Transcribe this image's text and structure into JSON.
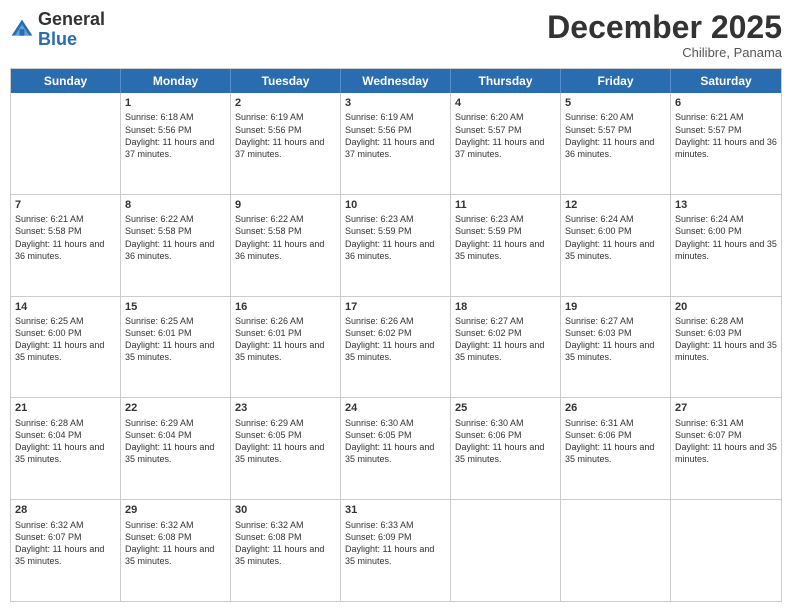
{
  "logo": {
    "general": "General",
    "blue": "Blue"
  },
  "title": "December 2025",
  "subtitle": "Chilibre, Panama",
  "header_days": [
    "Sunday",
    "Monday",
    "Tuesday",
    "Wednesday",
    "Thursday",
    "Friday",
    "Saturday"
  ],
  "weeks": [
    [
      {
        "day": "",
        "sunrise": "",
        "sunset": "",
        "daylight": ""
      },
      {
        "day": "1",
        "sunrise": "Sunrise: 6:18 AM",
        "sunset": "Sunset: 5:56 PM",
        "daylight": "Daylight: 11 hours and 37 minutes."
      },
      {
        "day": "2",
        "sunrise": "Sunrise: 6:19 AM",
        "sunset": "Sunset: 5:56 PM",
        "daylight": "Daylight: 11 hours and 37 minutes."
      },
      {
        "day": "3",
        "sunrise": "Sunrise: 6:19 AM",
        "sunset": "Sunset: 5:56 PM",
        "daylight": "Daylight: 11 hours and 37 minutes."
      },
      {
        "day": "4",
        "sunrise": "Sunrise: 6:20 AM",
        "sunset": "Sunset: 5:57 PM",
        "daylight": "Daylight: 11 hours and 37 minutes."
      },
      {
        "day": "5",
        "sunrise": "Sunrise: 6:20 AM",
        "sunset": "Sunset: 5:57 PM",
        "daylight": "Daylight: 11 hours and 36 minutes."
      },
      {
        "day": "6",
        "sunrise": "Sunrise: 6:21 AM",
        "sunset": "Sunset: 5:57 PM",
        "daylight": "Daylight: 11 hours and 36 minutes."
      }
    ],
    [
      {
        "day": "7",
        "sunrise": "Sunrise: 6:21 AM",
        "sunset": "Sunset: 5:58 PM",
        "daylight": "Daylight: 11 hours and 36 minutes."
      },
      {
        "day": "8",
        "sunrise": "Sunrise: 6:22 AM",
        "sunset": "Sunset: 5:58 PM",
        "daylight": "Daylight: 11 hours and 36 minutes."
      },
      {
        "day": "9",
        "sunrise": "Sunrise: 6:22 AM",
        "sunset": "Sunset: 5:58 PM",
        "daylight": "Daylight: 11 hours and 36 minutes."
      },
      {
        "day": "10",
        "sunrise": "Sunrise: 6:23 AM",
        "sunset": "Sunset: 5:59 PM",
        "daylight": "Daylight: 11 hours and 36 minutes."
      },
      {
        "day": "11",
        "sunrise": "Sunrise: 6:23 AM",
        "sunset": "Sunset: 5:59 PM",
        "daylight": "Daylight: 11 hours and 35 minutes."
      },
      {
        "day": "12",
        "sunrise": "Sunrise: 6:24 AM",
        "sunset": "Sunset: 6:00 PM",
        "daylight": "Daylight: 11 hours and 35 minutes."
      },
      {
        "day": "13",
        "sunrise": "Sunrise: 6:24 AM",
        "sunset": "Sunset: 6:00 PM",
        "daylight": "Daylight: 11 hours and 35 minutes."
      }
    ],
    [
      {
        "day": "14",
        "sunrise": "Sunrise: 6:25 AM",
        "sunset": "Sunset: 6:00 PM",
        "daylight": "Daylight: 11 hours and 35 minutes."
      },
      {
        "day": "15",
        "sunrise": "Sunrise: 6:25 AM",
        "sunset": "Sunset: 6:01 PM",
        "daylight": "Daylight: 11 hours and 35 minutes."
      },
      {
        "day": "16",
        "sunrise": "Sunrise: 6:26 AM",
        "sunset": "Sunset: 6:01 PM",
        "daylight": "Daylight: 11 hours and 35 minutes."
      },
      {
        "day": "17",
        "sunrise": "Sunrise: 6:26 AM",
        "sunset": "Sunset: 6:02 PM",
        "daylight": "Daylight: 11 hours and 35 minutes."
      },
      {
        "day": "18",
        "sunrise": "Sunrise: 6:27 AM",
        "sunset": "Sunset: 6:02 PM",
        "daylight": "Daylight: 11 hours and 35 minutes."
      },
      {
        "day": "19",
        "sunrise": "Sunrise: 6:27 AM",
        "sunset": "Sunset: 6:03 PM",
        "daylight": "Daylight: 11 hours and 35 minutes."
      },
      {
        "day": "20",
        "sunrise": "Sunrise: 6:28 AM",
        "sunset": "Sunset: 6:03 PM",
        "daylight": "Daylight: 11 hours and 35 minutes."
      }
    ],
    [
      {
        "day": "21",
        "sunrise": "Sunrise: 6:28 AM",
        "sunset": "Sunset: 6:04 PM",
        "daylight": "Daylight: 11 hours and 35 minutes."
      },
      {
        "day": "22",
        "sunrise": "Sunrise: 6:29 AM",
        "sunset": "Sunset: 6:04 PM",
        "daylight": "Daylight: 11 hours and 35 minutes."
      },
      {
        "day": "23",
        "sunrise": "Sunrise: 6:29 AM",
        "sunset": "Sunset: 6:05 PM",
        "daylight": "Daylight: 11 hours and 35 minutes."
      },
      {
        "day": "24",
        "sunrise": "Sunrise: 6:30 AM",
        "sunset": "Sunset: 6:05 PM",
        "daylight": "Daylight: 11 hours and 35 minutes."
      },
      {
        "day": "25",
        "sunrise": "Sunrise: 6:30 AM",
        "sunset": "Sunset: 6:06 PM",
        "daylight": "Daylight: 11 hours and 35 minutes."
      },
      {
        "day": "26",
        "sunrise": "Sunrise: 6:31 AM",
        "sunset": "Sunset: 6:06 PM",
        "daylight": "Daylight: 11 hours and 35 minutes."
      },
      {
        "day": "27",
        "sunrise": "Sunrise: 6:31 AM",
        "sunset": "Sunset: 6:07 PM",
        "daylight": "Daylight: 11 hours and 35 minutes."
      }
    ],
    [
      {
        "day": "28",
        "sunrise": "Sunrise: 6:32 AM",
        "sunset": "Sunset: 6:07 PM",
        "daylight": "Daylight: 11 hours and 35 minutes."
      },
      {
        "day": "29",
        "sunrise": "Sunrise: 6:32 AM",
        "sunset": "Sunset: 6:08 PM",
        "daylight": "Daylight: 11 hours and 35 minutes."
      },
      {
        "day": "30",
        "sunrise": "Sunrise: 6:32 AM",
        "sunset": "Sunset: 6:08 PM",
        "daylight": "Daylight: 11 hours and 35 minutes."
      },
      {
        "day": "31",
        "sunrise": "Sunrise: 6:33 AM",
        "sunset": "Sunset: 6:09 PM",
        "daylight": "Daylight: 11 hours and 35 minutes."
      },
      {
        "day": "",
        "sunrise": "",
        "sunset": "",
        "daylight": ""
      },
      {
        "day": "",
        "sunrise": "",
        "sunset": "",
        "daylight": ""
      },
      {
        "day": "",
        "sunrise": "",
        "sunset": "",
        "daylight": ""
      }
    ]
  ]
}
